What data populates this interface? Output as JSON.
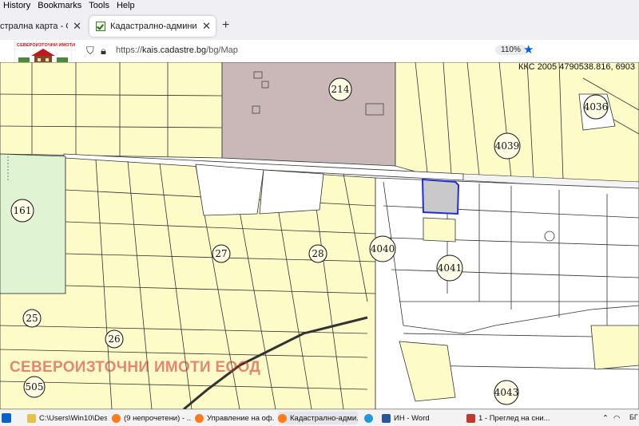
{
  "menu": {
    "items": [
      "History",
      "Bookmarks",
      "Tools",
      "Help"
    ]
  },
  "tabs": [
    {
      "title": "стрална карта - Google Та",
      "active": false
    },
    {
      "title": "Кадастрално-администрaтивен",
      "active": true
    }
  ],
  "navbar": {
    "url_prefix": "https://",
    "url_host": "kais.cadastre.bg",
    "url_path": "/bg/Map",
    "zoom": "110%"
  },
  "logo": {
    "text": "СЕВЕРОИЗТОЧНИ ИМОТИ"
  },
  "map": {
    "coordinates_readout": "ККС 2005 4790538.816, 6903",
    "watermark": "СЕВЕРОИЗТОЧНИ ИМОТИ ЕООД",
    "parcel_labels": [
      "214",
      "4036",
      "4039",
      "161",
      "27",
      "28",
      "4040",
      "4041",
      "25",
      "26",
      "505",
      "4043"
    ],
    "colors": {
      "parcel": "#fdfbc8",
      "industrial": "#c9b8b7",
      "green": "#e0f3d2",
      "selected": "#c9c9c9",
      "selected_border": "#1d2fd6"
    }
  },
  "taskbar": {
    "items": [
      {
        "label": "C:\\Users\\Win10\\Des...",
        "icon": "folder-icon"
      },
      {
        "label": "(9 непрочетени) - ...",
        "icon": "firefox-icon"
      },
      {
        "label": "Управление на оф...",
        "icon": "firefox-icon"
      },
      {
        "label": "Кадастрално-адми...",
        "icon": "firefox-icon"
      },
      {
        "label": "ИН - Word",
        "icon": "word-icon"
      },
      {
        "label": "1 - Преглед на сни...",
        "icon": "viewer-icon"
      }
    ],
    "lang": "БГ"
  }
}
